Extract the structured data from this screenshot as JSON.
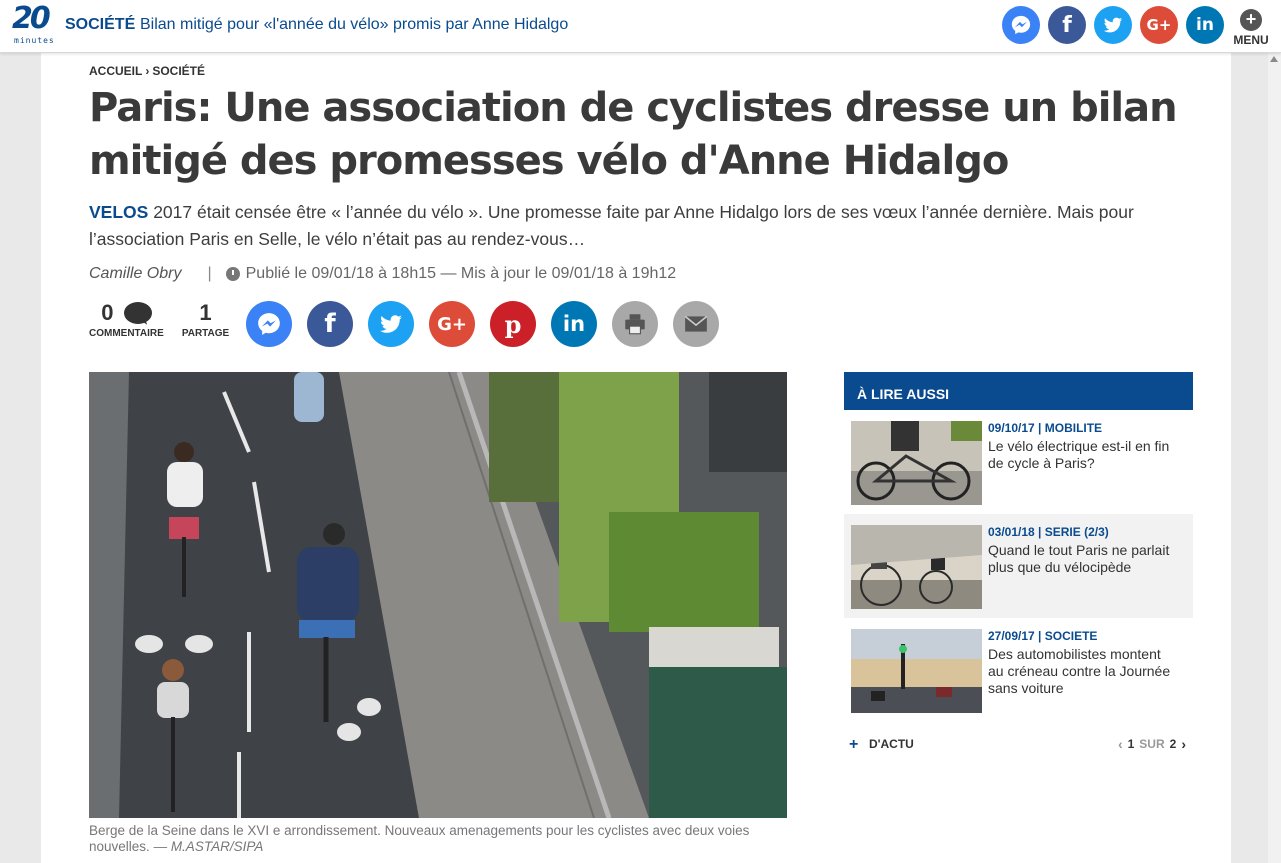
{
  "header": {
    "logo_number": "20",
    "logo_sub": "minutes",
    "section": "SOCIÉTÉ",
    "title": "Bilan mitigé pour «l'année du vélo» promis par Anne Hidalgo",
    "menu_label": "MENU",
    "menu_symbol": "+",
    "share_icons": [
      "messenger-icon",
      "facebook-icon",
      "twitter-icon",
      "google-plus-icon",
      "linkedin-icon"
    ]
  },
  "breadcrumb": {
    "home": "ACCUEIL",
    "separator": "›",
    "section": "SOCIÉTÉ"
  },
  "article": {
    "title": "Paris: Une association de cyclistes dresse un bilan mitigé des promesses vélo d'Anne Hidalgo",
    "kicker": "VELOS",
    "lead": "2017 était censée être « l’année du vélo ». Une promesse faite par Anne Hidalgo lors de ses vœux l’année dernière. Mais pour l’association Paris en Selle, le vélo n’était pas au rendez-vous…",
    "author": "Camille Obry",
    "separator": "|",
    "dates": "Publié le 09/01/18 à 18h15 — Mis à jour le 09/01/18 à 19h12",
    "comments_count": "0",
    "comments_label": "COMMENTAIRE",
    "shares_count": "1",
    "shares_label": "PARTAGE",
    "share_buttons": [
      "messenger-icon",
      "facebook-icon",
      "twitter-icon",
      "google-plus-icon",
      "pinterest-icon",
      "linkedin-icon",
      "print-icon",
      "email-icon"
    ],
    "photo_caption": "Berge de la Seine dans le XVI e arrondissement. Nouveaux amenagements pour les cyclistes avec deux voies nouvelles.",
    "photo_credit": "— M.ASTAR/SIPA"
  },
  "sidebar": {
    "heading": "À LIRE AUSSI",
    "items": [
      {
        "kicker": "09/10/17 | MOBILITE",
        "title": "Le vélo électrique est-il en fin de cycle à Paris?"
      },
      {
        "kicker": "03/01/18 | SERIE (2/3)",
        "title": "Quand le tout Paris ne parlait plus que du vélocipède"
      },
      {
        "kicker": "27/09/17 | SOCIETE",
        "title": "Des automobilistes montent au créneau contre la Journée sans voiture"
      }
    ],
    "more_symbol": "+",
    "more_label": "D'ACTU",
    "pager_current": "1",
    "pager_of": "SUR",
    "pager_total": "2"
  },
  "colors": {
    "brand": "#0a4b8f",
    "messenger": "#3b82f6",
    "facebook": "#3b5998",
    "twitter": "#1da1f2",
    "google_plus": "#dd4b39",
    "pinterest": "#cb2027",
    "linkedin": "#0077b5",
    "print": "#a8a8a8",
    "email": "#a8a8a8"
  }
}
